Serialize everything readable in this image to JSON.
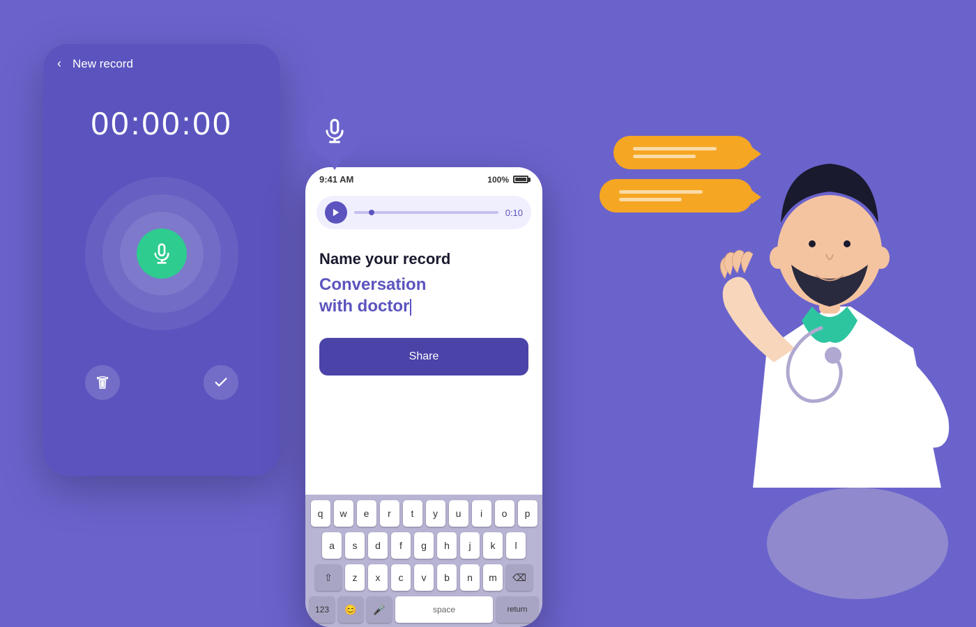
{
  "background_color": "#6B63CC",
  "left_phone": {
    "title": "New record",
    "back_label": "‹",
    "timer": "00:00:00"
  },
  "center_phone": {
    "status_time": "9:41 AM",
    "battery_pct": "100%",
    "audio_duration": "0:10",
    "name_label": "Name your record",
    "record_name": "Conversation\nwith doctor",
    "share_btn": "Share"
  },
  "conversation_text": "Conversation",
  "keyboard": {
    "row1": [
      "q",
      "w",
      "e",
      "r",
      "t",
      "y",
      "u",
      "i",
      "o",
      "p"
    ],
    "row2": [
      "a",
      "s",
      "d",
      "f",
      "g",
      "h",
      "j",
      "k",
      "l"
    ],
    "row3": [
      "z",
      "x",
      "c",
      "v",
      "b",
      "n",
      "m"
    ],
    "bottom": [
      "123",
      "😊",
      "mic",
      "space",
      "return"
    ]
  }
}
